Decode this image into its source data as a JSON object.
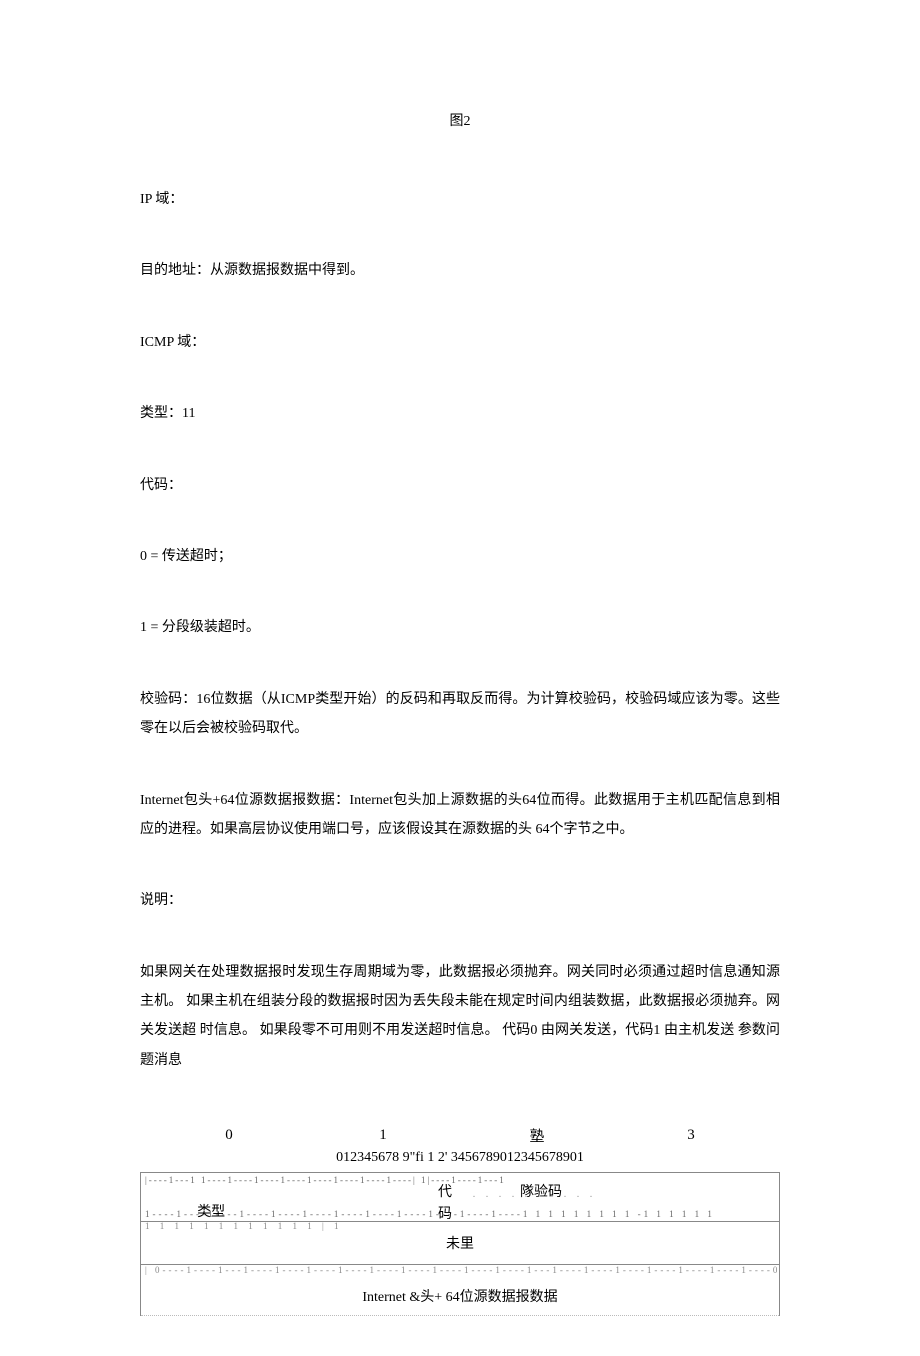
{
  "figure_label": "图2",
  "paragraphs": {
    "ip_domain_label": "IP 域：",
    "dest_addr": "目的地址：从源数据报数据中得到。",
    "icmp_domain_label": "ICMP 域：",
    "type_line": "类型：11",
    "code_label": "代码：",
    "code0": "0 = 传送超时；",
    "code1": "1 = 分段级装超时。",
    "checksum": "校验码：16位数据（从ICMP类型开始）的反码和再取反而得。为计算校验码，校验码域应该为零。这些 零在以后会被校验码取代。",
    "header64": "Internet包头+64位源数据报数据：Internet包头加上源数据的头64位而得。此数据用于主机匹配信息到相 应的进程。如果高层协议使用端口号，应该假设其在源数据的头 64个字节之中。",
    "description_label": "说明：",
    "description_body": "如果网关在处理数据报时发现生存周期域为零，此数据报必须抛弃。网关同时必须通过超时信息通知源主机。  如果主机在组装分段的数据报时因为丢失段未能在规定时间内组装数据，此数据报必须抛弃。网关发送超 时信息。  如果段零不可用则不用发送超时信息。  代码0 由网关发送，代码1 由主机发送  参数问题消息"
  },
  "diagram": {
    "header_cols": [
      "0",
      "1",
      "塾",
      "3"
    ],
    "ruler": "012345678 9\"fi 1 2' 3456789012345678901",
    "row1": {
      "type": "类型",
      "code": "代",
      "code2": "码",
      "checksum": "隊验码"
    },
    "row2": "未里",
    "row3": "Internet &头+  64位源数据报数据",
    "tick_pattern_a": "|----1---1  1----1----1----1----1----1----1----1----|  1|----1----1---1",
    "tick_pattern_b": "1----1----1----1----1----1----1----1----1----1----1----1----1     1   1 1 1   1   1  1  1 -1 1    1   1  1  1",
    "tick_pattern_c": "1     1   1   1   1   1   1   1   1   1   1 1        | 1",
    "tick_pattern_d": "|  0----1----1---1----1----1----1----1----1----1----1----1----1---1----1----1----1----1----1----1----0----|",
    "dots": ". . . . . . . . . ."
  }
}
